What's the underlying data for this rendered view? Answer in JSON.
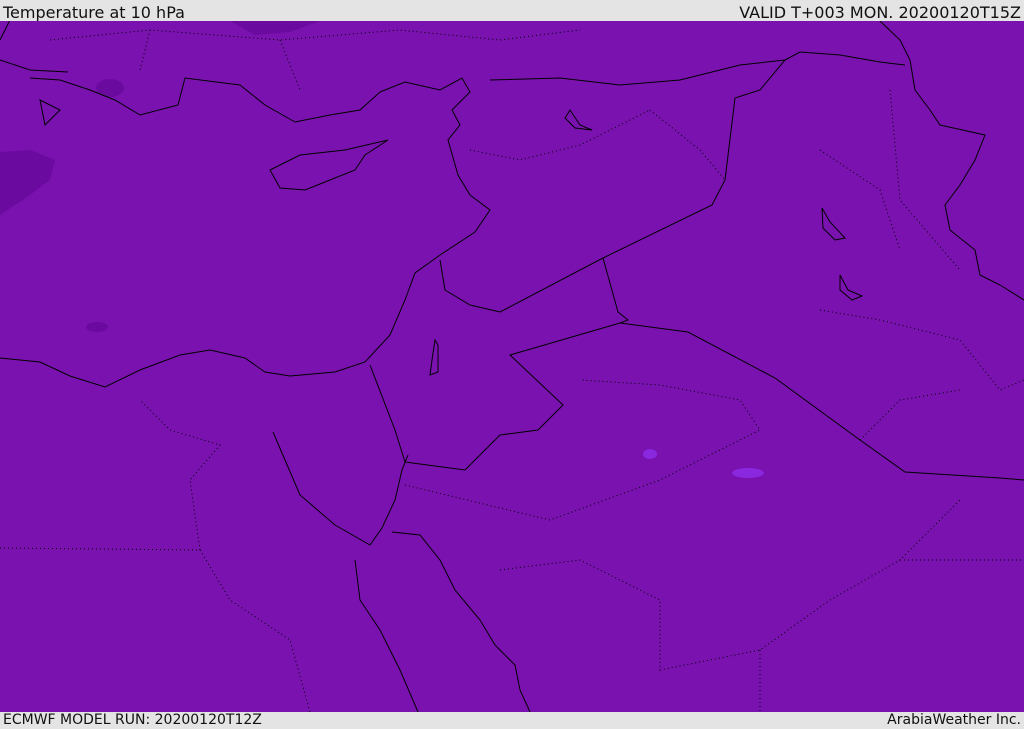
{
  "header": {
    "title": "Temperature at 10 hPa",
    "valid": "VALID T+003 MON. 20200120T15Z"
  },
  "footer": {
    "model_run": "ECMWF MODEL RUN: 20200120T12Z",
    "credit": "ArabiaWeather Inc."
  },
  "colors": {
    "field": "#7a12b0",
    "cold_patch": "#6a0a9e",
    "warm_patch": "#8a28e0",
    "coast": "#000000"
  }
}
